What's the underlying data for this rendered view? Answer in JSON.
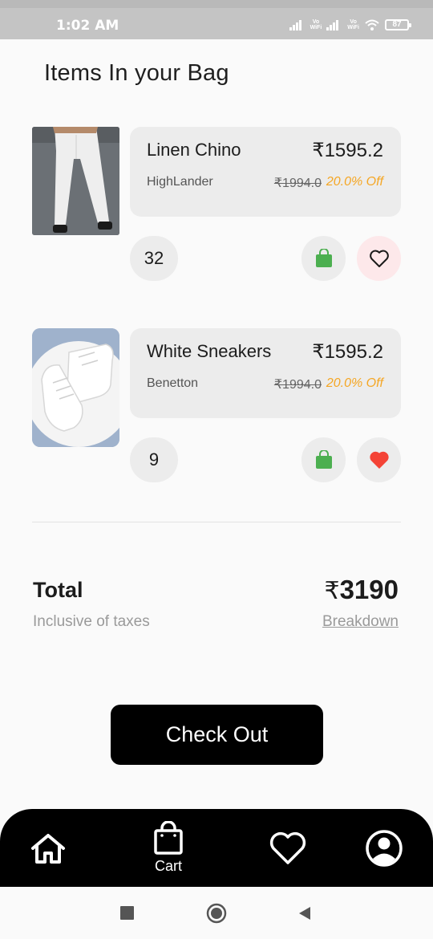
{
  "status_bar": {
    "time": "1:02 AM",
    "signal_label_1": "Vo\nWiFi",
    "signal_label_2": "Vo\nWiFi",
    "battery": "87"
  },
  "header": {
    "title": "Items In your Bag"
  },
  "items": [
    {
      "name": "Linen Chino",
      "price": "₹1595.2",
      "brand": "HighLander",
      "mrp": "₹1994.0",
      "discount": "20.0% Off",
      "quantity": "32",
      "favorited": false
    },
    {
      "name": "White Sneakers",
      "price": "₹1595.2",
      "brand": "Benetton",
      "mrp": "₹1994.0",
      "discount": "20.0% Off",
      "quantity": "9",
      "favorited": true
    }
  ],
  "summary": {
    "total_label": "Total",
    "total_sub": "Inclusive of taxes",
    "currency": "₹",
    "total_amount": "3190",
    "breakdown_label": "Breakdown"
  },
  "checkout": {
    "label": "Check Out"
  },
  "bottom_nav": {
    "items": [
      {
        "icon": "home-icon",
        "label": ""
      },
      {
        "icon": "shopping-bag-icon",
        "label": "Cart"
      },
      {
        "icon": "heart-icon",
        "label": ""
      },
      {
        "icon": "profile-icon",
        "label": ""
      }
    ]
  },
  "colors": {
    "accent_green": "#4caf50",
    "discount_orange": "#f5a623",
    "heart_red": "#f44336",
    "card_bg": "#ececec"
  }
}
